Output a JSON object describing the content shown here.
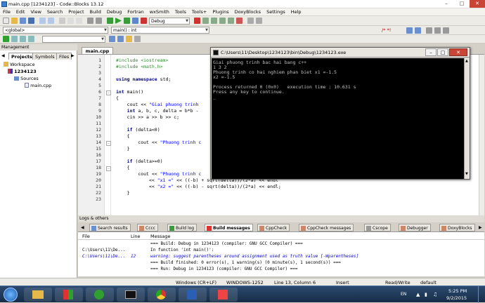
{
  "window": {
    "title": "main.cpp [1234123] - Code::Blocks 13.12"
  },
  "menu": [
    "File",
    "Edit",
    "View",
    "Search",
    "Project",
    "Build",
    "Debug",
    "Fortran",
    "wxSmith",
    "Tools",
    "Tools+",
    "Plugins",
    "DoxyBlocks",
    "Settings",
    "Help"
  ],
  "toolbar": {
    "build_target": "Debug",
    "scope": "<global>",
    "function": "main() : int",
    "regex_toolbar": "/** *< ",
    "regex_right": "/* *!"
  },
  "management": {
    "header": "Management",
    "tabs": [
      "Projects",
      "Symbols",
      "Files"
    ],
    "tree": {
      "workspace": "Workspace",
      "project": "1234123",
      "folder": "Sources",
      "file": "main.cpp"
    }
  },
  "editor": {
    "tab": "main.cpp",
    "line_numbers": [
      "1",
      "2",
      "3",
      "4",
      "5",
      "6",
      "7",
      "8",
      "9",
      "10",
      "11",
      "12",
      "13",
      "14",
      "15",
      "16",
      "17",
      "18",
      "19",
      "20",
      "21",
      "22",
      "23"
    ],
    "lines": {
      "l1": "#include <iostream>",
      "l2": "#include <math.h>",
      "l4a": "using namespace",
      "l4b": " std;",
      "l6a": "int",
      "l6b": " main()",
      "l7": "{",
      "l8a": "    cout << ",
      "l8b": "\"Giai phuong trinh",
      "l9a": "    int",
      "l9b": " a, b, c, delta = b*b -",
      "l10": "    cin >> a >> b >> c;",
      "l12a": "    if",
      "l12b": " (delta<0)",
      "l13": "    {",
      "l14a": "        cout << ",
      "l14b": "\"Phuong trinh c",
      "l15": "    }",
      "l17a": "    if",
      "l17b": " (delta>=0)",
      "l18": "    {",
      "l19a": "        cout << ",
      "l19b": "\"Phuong trinh c",
      "l20a": "            << ",
      "l20b": "\"x1 =\"",
      "l20c": " << ((-b) + sqrt(delta))/(2*a) << endl",
      "l21a": "            << ",
      "l21b": "\"x2 =\"",
      "l21c": " << ((-b) - sqrt(delta))/(2*a) << endl;",
      "l22": "    }",
      "l23": ""
    }
  },
  "console": {
    "title": "C:\\Users\\11\\Desktop\\1234123\\bin\\Debug\\1234123.exe",
    "output": "Giai phuong trinh bac hai bang c++\n1 3 2\nPhuong trinh co hai nghiem phan biet x1 =-1.5\nx2 =-1.5\n\nProcess returned 0 (0x0)   execution time : 10.631 s\nPress any key to continue.\n_"
  },
  "logs": {
    "header": "Logs & others",
    "tabs": [
      "Search results",
      "Cccc",
      "Build log",
      "Build messages",
      "CppCheck",
      "CppCheck messages",
      "Cscope",
      "Debugger",
      "DoxyBlocks"
    ],
    "active_tab": "Build messages",
    "columns": [
      "File",
      "Line",
      "Message"
    ],
    "rows": [
      {
        "file": "",
        "line": "",
        "message": "=== Build: Debug in 1234123 (compiler: GNU GCC Compiler) ==="
      },
      {
        "file": "C:\\Users\\11\\De...",
        "line": "",
        "message": "In function 'int main()':"
      },
      {
        "file": "C:\\Users\\11\\De...",
        "line": "12",
        "message": "warning: suggest parentheses around assignment used as truth value [-Wparentheses]"
      },
      {
        "file": "",
        "line": "",
        "message": "=== Build finished: 0 error(s), 1 warning(s) (0 minute(s), 1 second(s)) ==="
      },
      {
        "file": "",
        "line": "",
        "message": "=== Run: Debug in 1234123 (compiler: GNU GCC Compiler) ==="
      }
    ]
  },
  "status": {
    "eol": "Windows (CR+LF)",
    "encoding": "WINDOWS-1252",
    "position": "Line 13, Column 6",
    "mode": "Insert",
    "rw": "Read/Write",
    "profile": "default"
  },
  "taskbar": {
    "lang": "EN",
    "time": "5:25 PM",
    "date": "9/2/2015"
  },
  "colors": {
    "warning": "#0000cc",
    "preprocessor": "#2b8a2b",
    "keyword": "#00008b",
    "string": "#0000ff"
  }
}
